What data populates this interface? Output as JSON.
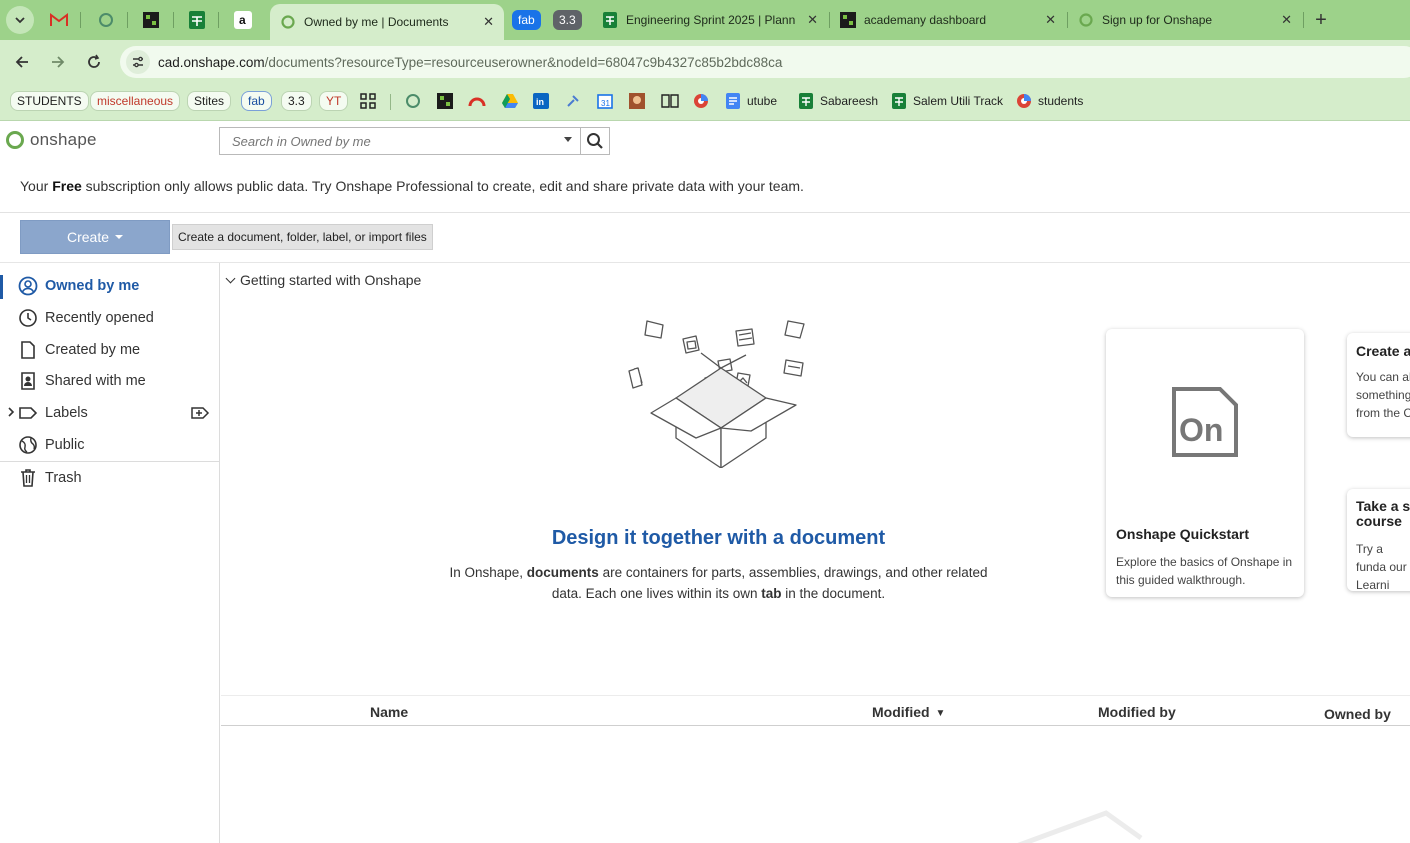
{
  "browser": {
    "tabs": [
      {
        "title": "Owned by me | Documents",
        "active": true
      },
      {
        "title": "fab",
        "kind": "group",
        "color": "#1a73e8"
      },
      {
        "title": "3.3",
        "kind": "group",
        "color": "#5f6368"
      },
      {
        "title": "Engineering Sprint 2025 | Plann"
      },
      {
        "title": "academany dashboard"
      },
      {
        "title": "Sign up for Onshape"
      }
    ],
    "new_tab_label": "+",
    "close_glyph": "✕",
    "url_host": "cad.onshape.com",
    "url_path": "/documents?resourceType=resourceuserowner&nodeId=68047c9b4327c85b2bdc88ca",
    "bookmarks": [
      {
        "label": "STUDENTS"
      },
      {
        "label": "miscellaneous",
        "color": "#c0392b"
      },
      {
        "label": "Stites"
      },
      {
        "label": "fab",
        "color": "#1a4fa0"
      },
      {
        "label": "3.3"
      },
      {
        "label": "YT",
        "color": "#c0392b"
      },
      {
        "label": "utube"
      },
      {
        "label": "Sabareesh"
      },
      {
        "label": "Salem Utili Track"
      },
      {
        "label": "students"
      }
    ]
  },
  "app": {
    "logo_text": "onshape",
    "search_placeholder": "Search in Owned by me",
    "notice_prefix": "Your ",
    "notice_bold": "Free",
    "notice_suffix": " subscription only allows public data. Try Onshape Professional to create, edit and share private data with your team.",
    "create_label": "Create",
    "create_tooltip": "Create a document, folder, label, or import files",
    "sidebar": [
      {
        "label": "Owned by me",
        "icon": "user-circle-icon",
        "active": true
      },
      {
        "label": "Recently opened",
        "icon": "clock-icon"
      },
      {
        "label": "Created by me",
        "icon": "document-icon"
      },
      {
        "label": "Shared with me",
        "icon": "shared-user-icon"
      },
      {
        "label": "Labels",
        "icon": "label-tag-icon"
      },
      {
        "label": "Public",
        "icon": "globe-icon"
      },
      {
        "label": "Trash",
        "icon": "trash-icon"
      }
    ],
    "getting_started": "Getting started with Onshape",
    "hero_title": "Design it together with a document",
    "hero_text_1": "In Onshape, ",
    "hero_text_bold1": "documents",
    "hero_text_2": " are containers for parts, assemblies, drawings, and other related data. Each one lives within its own ",
    "hero_text_bold2": "tab",
    "hero_text_3": " in the document.",
    "cards": [
      {
        "title": "Onshape Quickstart",
        "text": "Explore the basics of Onshape in this guided walkthrough.",
        "logo_text": "On"
      },
      {
        "title": "Create a",
        "text": "You can al something from the C"
      },
      {
        "title": "Take a s course",
        "text": "Try a funda our Learni"
      }
    ],
    "table_headers": {
      "name": "Name",
      "modified": "Modified",
      "modified_sort_glyph": "▼",
      "modified_by": "Modified by",
      "owned_by": "Owned by"
    }
  }
}
